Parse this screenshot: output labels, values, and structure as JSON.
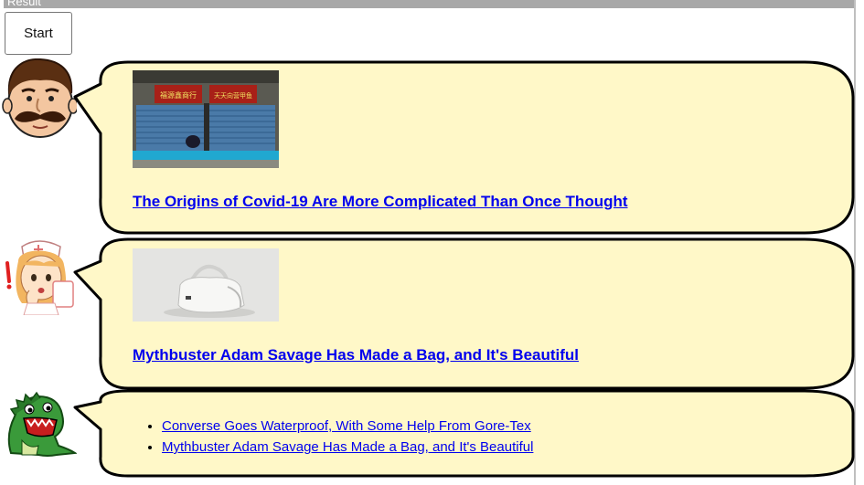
{
  "header": {
    "title": "Result"
  },
  "controls": {
    "start_label": "Start"
  },
  "colors": {
    "bubble_fill": "#fff8c8",
    "bubble_stroke": "#000000",
    "link": "#0000ee"
  },
  "feed": {
    "items": [
      {
        "character": "mustache-man",
        "headline": "The Origins of Covid-19 Are More Complicated Than Once Thought",
        "image": "storefront-shutters-photo",
        "sign_left": "福源鑫商行",
        "sign_right": "天天向营甲鱼"
      },
      {
        "character": "surprised-nurse",
        "headline": "Mythbuster Adam Savage Has Made a Bag, and It's Beautiful",
        "image": "white-bag-photo"
      },
      {
        "character": "green-dinosaur",
        "links": [
          "Converse Goes Waterproof, With Some Help From Gore-Tex",
          "Mythbuster Adam Savage Has Made a Bag, and It's Beautiful"
        ]
      }
    ]
  }
}
